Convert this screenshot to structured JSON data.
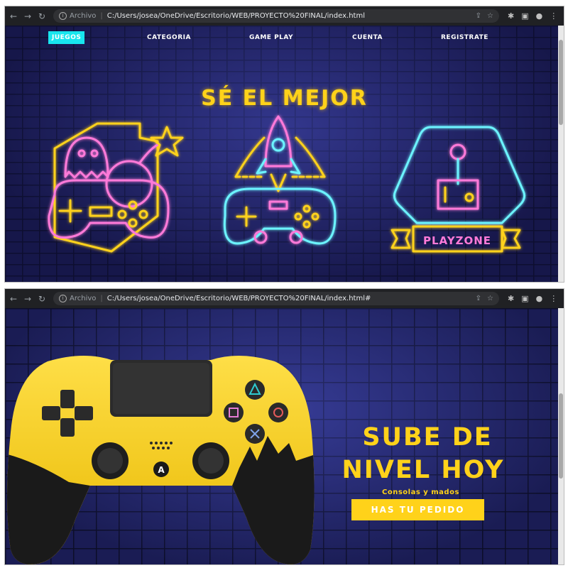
{
  "browser": {
    "origin_label": "Archivo",
    "url_1": "C:/Users/josea/OneDrive/Escritorio/WEB/PROYECTO%20FINAL/index.html",
    "url_2": "C:/Users/josea/OneDrive/Escritorio/WEB/PROYECTO%20FINAL/index.html#"
  },
  "nav": {
    "items": [
      "JUEGOS",
      "CATEGORIA",
      "GAME PLAY",
      "CUENTA",
      "REGISTRATE"
    ]
  },
  "hero": {
    "title": "SÉ EL MEJOR",
    "badge_text": "PLAYZONE"
  },
  "promo": {
    "title_line1": "SUBE DE",
    "title_line2": "NIVEL HOY",
    "subtitle": "Consolas y mados",
    "button_label": "HAS TU PEDIDO",
    "controller_center_letter": "A"
  },
  "colors": {
    "accent_yellow": "#ffd21a",
    "nav_active": "#18e5ee",
    "brick_blue": "#1e1f63"
  }
}
